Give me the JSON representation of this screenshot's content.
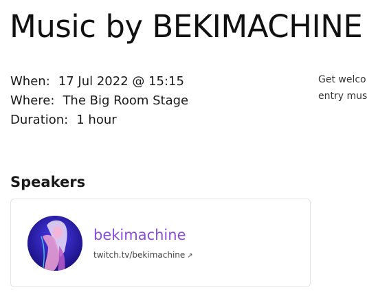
{
  "event": {
    "title": "Music by BEKIMACHINE",
    "details": [
      {
        "label": "When:",
        "value": "17 Jul 2022 @ 15:15"
      },
      {
        "label": "Where:",
        "value": "The Big Room Stage"
      },
      {
        "label": "Duration:",
        "value": "1 hour"
      }
    ],
    "description_lines": [
      "Get welco",
      "entry mus"
    ]
  },
  "speakers": {
    "heading": "Speakers",
    "items": [
      {
        "name": "bekimachine",
        "link": "twitch.tv/bekimachine",
        "link_icon": "external-link-icon",
        "link_glyph": "↗"
      }
    ]
  },
  "colors": {
    "speaker_name": "#8a4ce0",
    "avatar_background": "#2418a8",
    "card_border": "#e4e4e4"
  }
}
